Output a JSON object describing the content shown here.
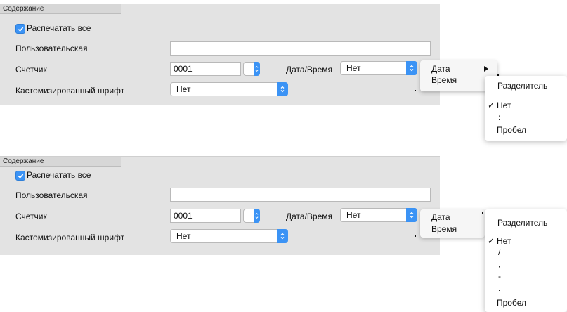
{
  "panels": [
    {
      "header": "Содержание",
      "print_all": "Распечатать все",
      "custom_label": "Пользовательская",
      "custom_value": "",
      "counter_label": "Счетчик",
      "counter_value": "0001",
      "datetime_label": "Дата/Время",
      "datetime_value": "Нет",
      "font_label": "Кастомизированный шрифт",
      "font_value": "Нет",
      "menu": {
        "date": "Дата",
        "time": "Время"
      },
      "submenu": {
        "title": "Разделитель",
        "checkmark": "✓",
        "items": [
          "Нет",
          ":",
          "Пробел"
        ]
      }
    },
    {
      "header": "Содержание",
      "print_all": "Распечатать все",
      "custom_label": "Пользовательская",
      "custom_value": "",
      "counter_label": "Счетчик",
      "counter_value": "0001",
      "datetime_label": "Дата/Время",
      "datetime_value": "Нет",
      "font_label": "Кастомизированный шрифт",
      "font_value": "Нет",
      "menu": {
        "date": "Дата",
        "time": "Время"
      },
      "submenu": {
        "title": "Разделитель",
        "checkmark": "✓",
        "items": [
          "Нет",
          "/",
          ",",
          "-",
          ".",
          "Пробел"
        ]
      }
    }
  ],
  "colors": {
    "accent": "#3b93f5",
    "panel_bg": "#e3e3e3"
  },
  "icons": {
    "check": "checkmark-icon",
    "stepper": "stepper-arrows-icon",
    "select": "popup-arrows-icon",
    "submenu": "submenu-arrow-icon"
  }
}
